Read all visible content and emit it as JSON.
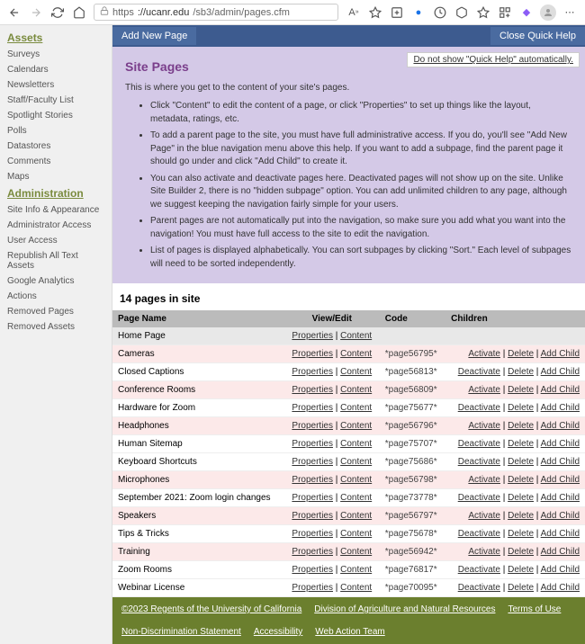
{
  "url": {
    "protocol": "https",
    "host": "://ucanr.edu",
    "path": "/sb3/admin/pages.cfm"
  },
  "sidebar": {
    "sections": [
      {
        "title": "Assets",
        "items": [
          "Surveys",
          "Calendars",
          "Newsletters",
          "Staff/Faculty List",
          "Spotlight Stories",
          "Polls",
          "Datastores",
          "Comments",
          "Maps"
        ]
      },
      {
        "title": "Administration",
        "items": [
          "Site Info & Appearance",
          "Administrator Access",
          "User Access",
          "Republish All Text Assets",
          "Google Analytics",
          "Actions",
          "Removed Pages",
          "Removed Assets"
        ]
      }
    ]
  },
  "bluebar": {
    "add": "Add New Page",
    "close": "Close Quick Help"
  },
  "help": {
    "autolink": "Do not show \"Quick Help\" automatically.",
    "title": "Site Pages",
    "intro": "This is where you get to the content of your site's pages.",
    "bullets": [
      "Click \"Content\" to edit the content of a page, or click \"Properties\" to set up things like the layout, metadata, ratings, etc.",
      "To add a parent page to the site, you must have full administrative access. If you do, you'll see \"Add New Page\" in the blue navigation menu above this help. If you want to add a subpage, find the parent page it should go under and click \"Add Child\" to create it.",
      "You can also activate and deactivate pages here. Deactivated pages will not show up on the site. Unlike Site Builder 2, there is no \"hidden subpage\" option. You can add unlimited children to any page, although we suggest keeping the navigation fairly simple for your users.",
      "Parent pages are not automatically put into the navigation, so make sure you add what you want into the navigation! You must have full access to the site to edit the navigation.",
      "List of pages is displayed alphabetically. You can sort subpages by clicking \"Sort.\" Each level of subpages will need to be sorted independently."
    ]
  },
  "count": "14 pages in site",
  "cols": {
    "name": "Page Name",
    "viewedit": "View/Edit",
    "code": "Code",
    "children": "Children"
  },
  "labels": {
    "properties": "Properties",
    "content": "Content",
    "activate": "Activate",
    "deactivate": "Deactivate",
    "delete": "Delete",
    "addchild": "Add Child"
  },
  "rows": [
    {
      "name": "Home Page",
      "code": "",
      "state": "home",
      "pink": false
    },
    {
      "name": "Cameras",
      "code": "*page56795*",
      "state": "activate",
      "pink": true
    },
    {
      "name": "Closed Captions",
      "code": "*page56813*",
      "state": "deactivate",
      "pink": false
    },
    {
      "name": "Conference Rooms",
      "code": "*page56809*",
      "state": "activate",
      "pink": true
    },
    {
      "name": "Hardware for Zoom",
      "code": "*page75677*",
      "state": "deactivate",
      "pink": false
    },
    {
      "name": "Headphones",
      "code": "*page56796*",
      "state": "activate",
      "pink": true
    },
    {
      "name": "Human Sitemap",
      "code": "*page75707*",
      "state": "deactivate",
      "pink": false
    },
    {
      "name": "Keyboard Shortcuts",
      "code": "*page75686*",
      "state": "deactivate",
      "pink": false
    },
    {
      "name": "Microphones",
      "code": "*page56798*",
      "state": "activate",
      "pink": true
    },
    {
      "name": "September 2021: Zoom login changes",
      "code": "*page73778*",
      "state": "deactivate",
      "pink": false
    },
    {
      "name": "Speakers",
      "code": "*page56797*",
      "state": "activate",
      "pink": true
    },
    {
      "name": "Tips & Tricks",
      "code": "*page75678*",
      "state": "deactivate",
      "pink": false
    },
    {
      "name": "Training",
      "code": "*page56942*",
      "state": "activate",
      "pink": true
    },
    {
      "name": "Zoom Rooms",
      "code": "*page76817*",
      "state": "deactivate",
      "pink": false
    },
    {
      "name": "Webinar License",
      "code": "*page70095*",
      "state": "deactivate",
      "pink": false
    }
  ],
  "footer": {
    "copyright": "©2023 Regents of the University of California",
    "links": [
      "Division of Agriculture and Natural Resources",
      "Terms of Use",
      "Non-Discrimination Statement",
      "Accessibility",
      "Web Action Team"
    ]
  }
}
